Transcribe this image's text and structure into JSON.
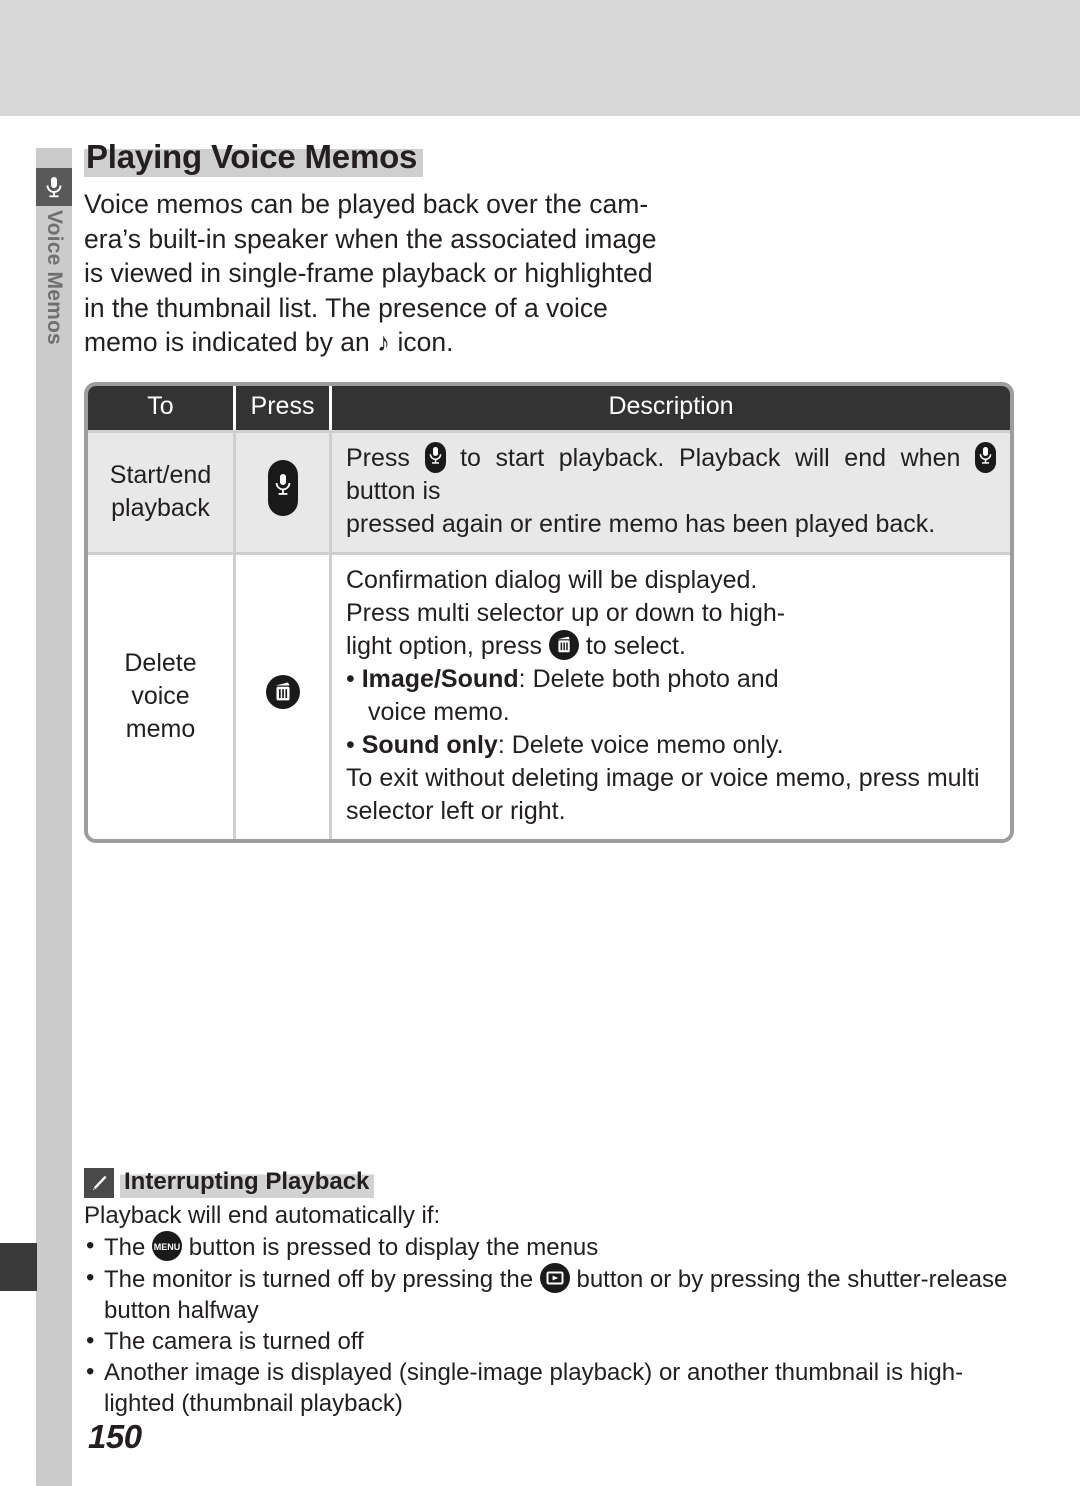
{
  "sidebar": {
    "chapter_label": "Voice Memos",
    "icon": "microphone-icon"
  },
  "heading": "Playing Voice Memos",
  "intro": {
    "line1": "Voice memos can be played back over the cam-",
    "line2": "era’s built-in speaker when the associated image",
    "line3": "is viewed in single-frame playback or highlighted",
    "line4": "in the thumbnail list.   The presence of a voice",
    "line5_before": "memo is indicated by an",
    "note_glyph": "♪",
    "line5_after": "icon."
  },
  "table": {
    "headers": {
      "to": "To",
      "press": "Press",
      "description": "Description"
    },
    "rows": [
      {
        "to": "Start/end\nplayback",
        "press_icon": "mic-button-icon",
        "desc_seg1": "Press",
        "desc_icon1": "mic-button-icon",
        "desc_seg2": "to start playback.  Playback will end when",
        "desc_icon2": "mic-button-icon",
        "desc_seg3": "button is",
        "desc_seg4": "pressed again or entire memo has been played back."
      },
      {
        "to_line1": "Delete",
        "to_line2": "voice",
        "to_line3": "memo",
        "press_icon": "trash-button-icon",
        "desc_line1": "Confirmation  dialog  will  be  displayed.",
        "desc_line2": "Press multi selector up or down to high-",
        "desc_line3_before": "light option, press",
        "desc_line3_icon": "trash-button-icon",
        "desc_line3_after": "to select.",
        "bullet1_label": "Image/Sound",
        "bullet1_text": ": Delete both photo and",
        "bullet1_cont": "voice memo.",
        "bullet2_label": "Sound only",
        "bullet2_text": ": Delete voice memo only.",
        "desc_line4": "To  exit  without  deleting  image  or  voice  memo,  press  multi",
        "desc_line5": "selector left or right."
      }
    ]
  },
  "note": {
    "icon": "pencil-icon",
    "title": "Interrupting Playback",
    "lead": "Playback will end automatically if:",
    "items": [
      {
        "before": "The",
        "icon": "menu-button-icon",
        "after": "button is pressed to display the menus",
        "cont": ""
      },
      {
        "before": "The monitor is turned off by pressing the",
        "icon": "playback-button-icon",
        "after": "button or by pressing the shutter-release",
        "cont": "button halfway"
      },
      {
        "before": "The camera is turned off",
        "icon": "",
        "after": "",
        "cont": ""
      },
      {
        "before": "Another  image  is  displayed  (single-image  playback)  or  another  thumbnail  is  high-",
        "icon": "",
        "after": "",
        "cont": "lighted (thumbnail playback)"
      }
    ]
  },
  "page_number": "150",
  "colors": {
    "band": "#d8d8d8",
    "rail": "#cbcbcb",
    "icon_box": "#595959",
    "table_header": "#333333",
    "row_shade": "#e8e8e8",
    "highlight": "#cfcfcf"
  }
}
